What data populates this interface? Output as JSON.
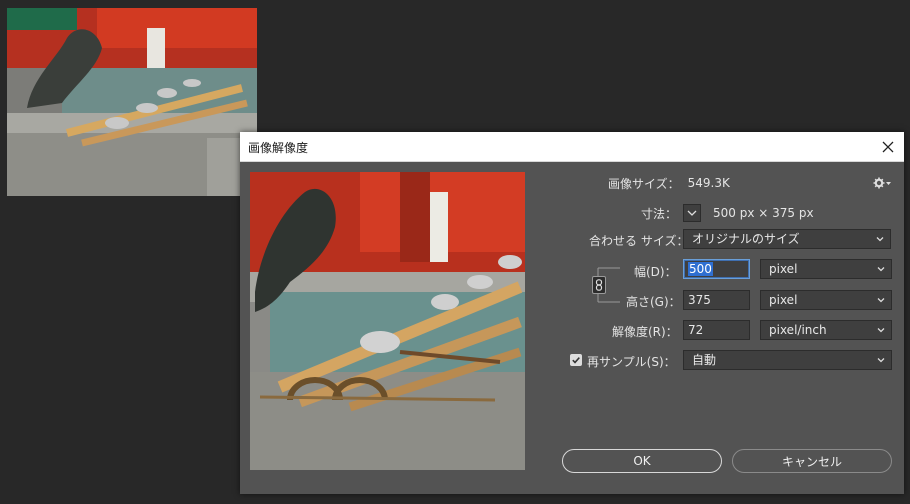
{
  "dialog": {
    "title": "画像解像度",
    "image_size_label": "画像サイズ：",
    "image_size_value": "549.3K",
    "dimensions_label": "寸法：",
    "dimensions_value": "500 px × 375 px",
    "fit_to_label": "合わせる サイズ：",
    "fit_to_value": "オリジナルのサイズ",
    "width_label": "幅(D)：",
    "width_value": "500",
    "width_unit": "pixel",
    "height_label": "高さ(G)：",
    "height_value": "375",
    "height_unit": "pixel",
    "resolution_label": "解像度(R)：",
    "resolution_value": "72",
    "resolution_unit": "pixel/inch",
    "resample_label": "再サンプル(S)：",
    "resample_checked": true,
    "resample_value": "自動",
    "ok_label": "OK",
    "cancel_label": "キャンセル"
  },
  "colors": {
    "dialog_bg": "#535353",
    "field_bg": "#3f3f3f",
    "focus": "#2f6fd1",
    "shrine_red": "#c9321c"
  }
}
